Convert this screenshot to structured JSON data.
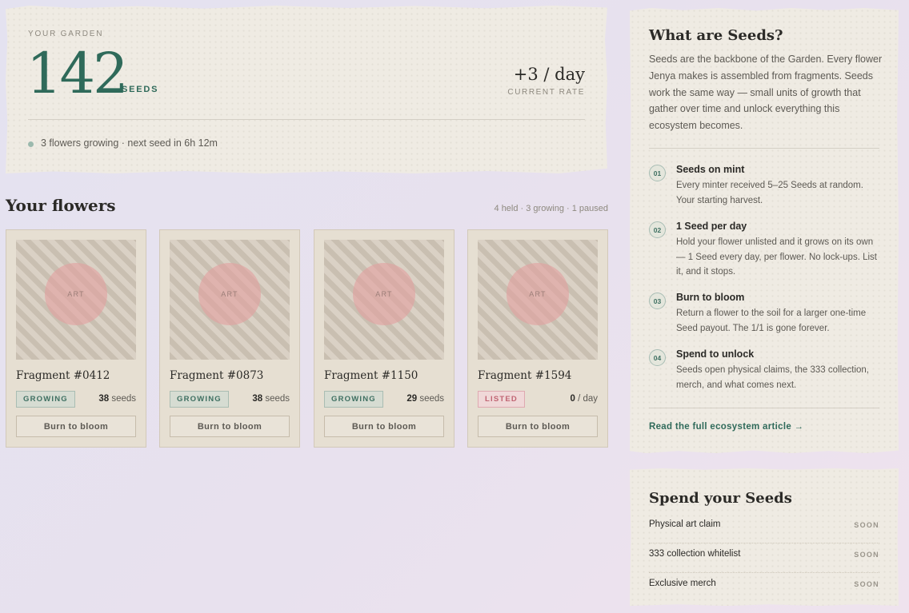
{
  "garden": {
    "label": "YOUR GARDEN",
    "seed_count": "142",
    "seed_unit": "SEEDS",
    "rate_value": "+3 / day",
    "rate_label": "CURRENT RATE",
    "status_text": "3 flowers growing · next seed in 6h 12m"
  },
  "flowers": {
    "title": "Your flowers",
    "summary": "4 held · 3 growing · 1 paused",
    "art_label": "ART",
    "button_label": "Burn to bloom",
    "items": [
      {
        "name": "Fragment #0412",
        "status": "GROWING",
        "value": "38",
        "unit": "seeds"
      },
      {
        "name": "Fragment #0873",
        "status": "GROWING",
        "value": "38",
        "unit": "seeds"
      },
      {
        "name": "Fragment #1150",
        "status": "GROWING",
        "value": "29",
        "unit": "seeds"
      },
      {
        "name": "Fragment #1594",
        "status": "LISTED",
        "value": "0",
        "unit": "/ day"
      }
    ]
  },
  "info": {
    "title": "What are Seeds?",
    "intro": "Seeds are the backbone of the Garden. Every flower Jenya makes is assembled from fragments. Seeds work the same way — small units of growth that gather over time and unlock everything this ecosystem becomes.",
    "steps": [
      {
        "num": "01",
        "title": "Seeds on mint",
        "text": "Every minter received 5–25 Seeds at random. Your starting harvest."
      },
      {
        "num": "02",
        "title": "1 Seed per day",
        "text": "Hold your flower unlisted and it grows on its own — 1 Seed every day, per flower. No lock-ups. List it, and it stops."
      },
      {
        "num": "03",
        "title": "Burn to bloom",
        "text": "Return a flower to the soil for a larger one-time Seed payout. The 1/1 is gone forever."
      },
      {
        "num": "04",
        "title": "Spend to unlock",
        "text": "Seeds open physical claims, the 333 collection, merch, and what comes next."
      }
    ],
    "link": "Read the full ecosystem article →"
  },
  "spend": {
    "title": "Spend your Seeds",
    "items": [
      {
        "label": "Physical art claim",
        "status": "SOON"
      },
      {
        "label": "333 collection whitelist",
        "status": "SOON"
      },
      {
        "label": "Exclusive merch",
        "status": "SOON"
      }
    ]
  },
  "colors": {
    "accent": "#2f6a5a",
    "listed": "#c06472",
    "background": "#e6e2ef",
    "paper": "#efebe3"
  }
}
